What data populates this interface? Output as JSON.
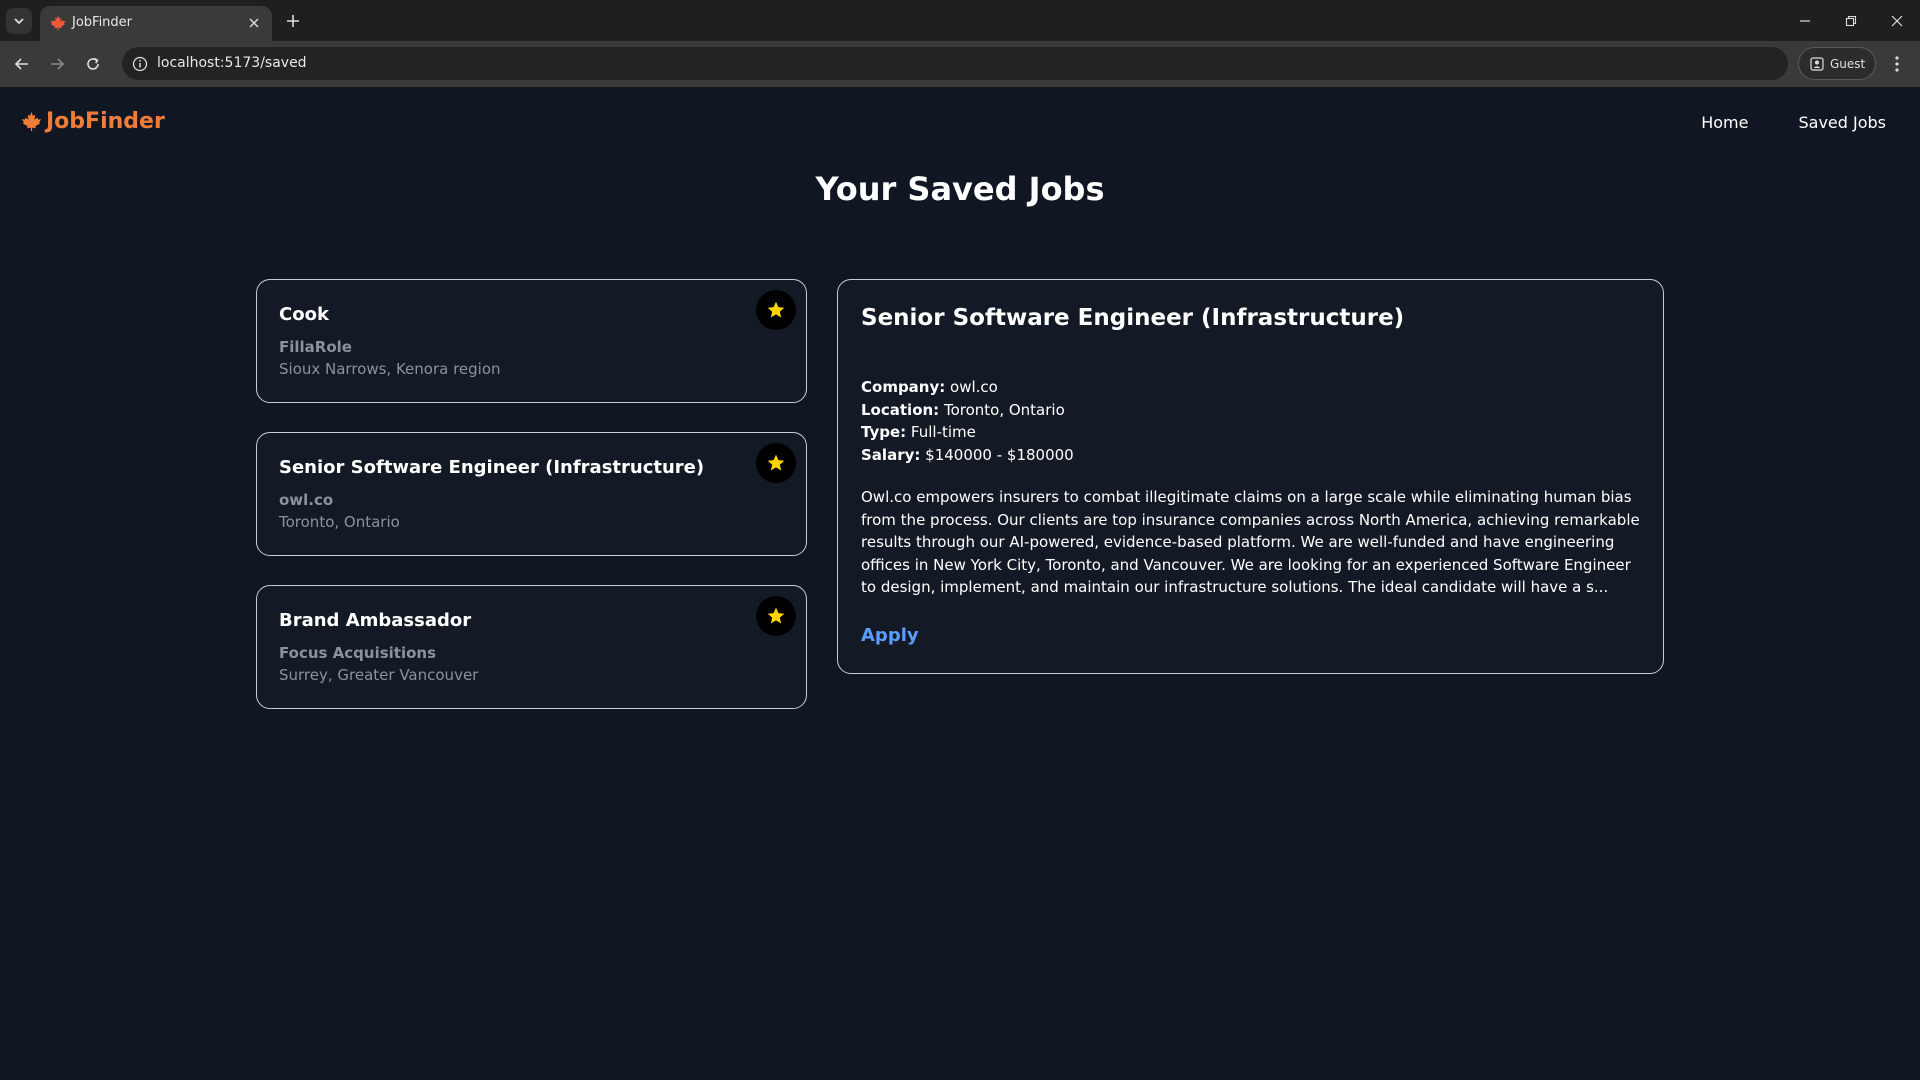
{
  "browser": {
    "tab_title": "JobFinder",
    "url": "localhost:5173/saved",
    "profile_label": "Guest"
  },
  "app": {
    "brand": "JobFinder",
    "brand_color": "#f07c3a",
    "nav": [
      {
        "label": "Home"
      },
      {
        "label": "Saved Jobs"
      }
    ]
  },
  "page_title": "Your Saved Jobs",
  "saved_jobs": [
    {
      "title": "Cook",
      "company": "FillaRole",
      "location": "Sioux Narrows, Kenora region",
      "saved": true
    },
    {
      "title": "Senior Software Engineer (Infrastructure)",
      "company": "owl.co",
      "location": "Toronto, Ontario",
      "saved": true
    },
    {
      "title": "Brand Ambassador",
      "company": "Focus Acquisitions",
      "location": "Surrey, Greater Vancouver",
      "saved": true
    }
  ],
  "detail": {
    "title": "Senior Software Engineer (Infrastructure)",
    "company_label": "Company:",
    "company": "owl.co",
    "location_label": "Location:",
    "location": "Toronto, Ontario",
    "type_label": "Type:",
    "type": "Full-time",
    "salary_label": "Salary:",
    "salary": "$140000 - $180000",
    "description": "Owl.co empowers insurers to combat illegitimate claims on a large scale while eliminating human bias from the process. Our clients are top insurance companies across North America, achieving remarkable results through our AI-powered, evidence-based platform. We are well-funded and have engineering offices in New York City, Toronto, and Vancouver. We are looking for an experienced Software Engineer to design, implement, and maintain our infrastructure solutions. The ideal candidate will have a s...",
    "apply_label": "Apply"
  },
  "colors": {
    "page_bg": "#111722",
    "star": "#ffd400",
    "apply_link": "#5b9dff"
  }
}
